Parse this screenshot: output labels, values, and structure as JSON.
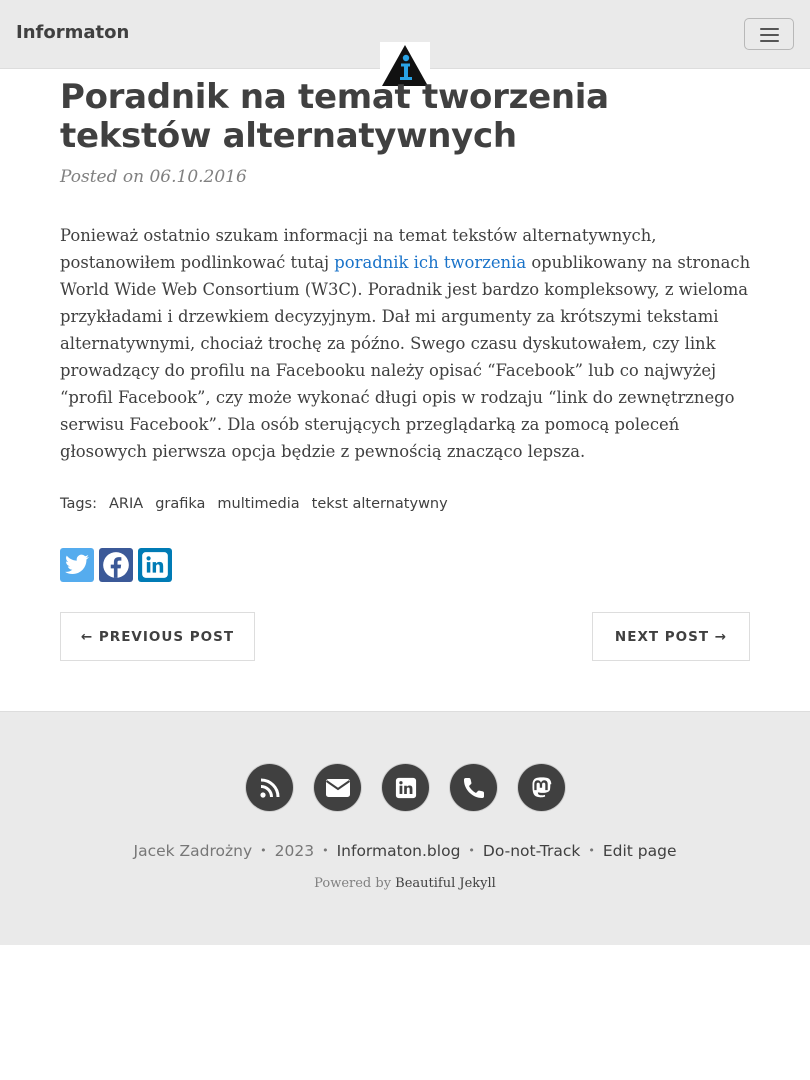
{
  "navbar": {
    "brand": "Informaton"
  },
  "post": {
    "title": "Poradnik na temat tworzenia tekstów alternatywnych",
    "meta": "Posted on 06.10.2016",
    "body_before_link": "Ponieważ ostatnio szukam informacji na temat tekstów alternatywnych, postanowiłem podlinkować tutaj ",
    "link_text": "poradnik ich tworzenia",
    "body_after_link": " opublikowany na stronach World Wide Web Consortium (W3C). Poradnik jest bardzo kompleksowy, z wieloma przykładami i drzewkiem decyzyjnym. Dał mi argumenty za krótszymi tekstami alternatywnymi, chociaż trochę za późno. Swego czasu dyskutowałem, czy link prowadzący do profilu na Facebooku należy opisać “Facebook” lub co najwyżej “profil Facebook”, czy może wykonać długi opis w rodzaju “link do zewnętrznego serwisu Facebook”. Dla osób sterujących przeglądarką za pomocą poleceń głosowych pierwsza opcja będzie z pewnością znacząco lepsza."
  },
  "tags": {
    "label": "Tags:",
    "items": [
      "ARIA",
      "grafika",
      "multimedia",
      "tekst alternatywny"
    ]
  },
  "share": {
    "icons": [
      "twitter-icon",
      "facebook-icon",
      "linkedin-icon"
    ],
    "colors": {
      "twitter": "#55acee",
      "facebook": "#3b5998",
      "linkedin": "#007bb5"
    }
  },
  "pager": {
    "previous": "← PREVIOUS POST",
    "next": "NEXT POST →"
  },
  "footer": {
    "social_icons": [
      "rss-icon",
      "envelope-icon",
      "linkedin-icon",
      "phone-icon",
      "mastodon-icon"
    ],
    "author": "Jacek Zadrożny",
    "year": "2023",
    "blog_link": "Informaton.blog",
    "dnt_link": "Do-not-Track",
    "edit_link": "Edit page",
    "powered_prefix": "Powered by ",
    "powered_link": "Beautiful Jekyll"
  }
}
